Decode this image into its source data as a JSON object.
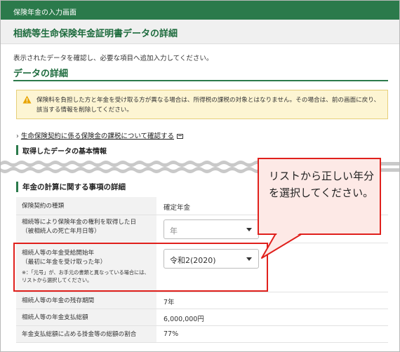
{
  "topbar": {
    "title": "保険年金の入力画面"
  },
  "page": {
    "title": "相続等生命保険年金証明書データの詳細"
  },
  "intro": "表示されたデータを確認し、必要な項目へ追加入力してください。",
  "section": {
    "title": "データの詳細"
  },
  "warning": {
    "icon": "warning-icon",
    "text": "保険料を負担した方と年金を受け取る方が異なる場合は、所得税の課税の対象とはなりません。その場合は、前の画面に戻り、該当する情報を削除してください。"
  },
  "link": {
    "text": "生命保険契約に係る保険金の課税について確認する",
    "icon": "external-link-icon"
  },
  "basic_info": {
    "title": "取得したデータの基本情報"
  },
  "calc": {
    "title": "年金の計算に関する事項の詳細",
    "rows": [
      {
        "label": "保険契約の種類",
        "value": "確定年金"
      },
      {
        "label": "相続等により保険年金の権利を取得した日\n（被相続人の死亡年月日等）",
        "select_placeholder": "年"
      },
      {
        "label": "相続人等の年金受給開始年\n（最初に年金を受け取った年）",
        "note": "※：「元号」が、お手元の書類と異なっている場合には、リストから選択してください。",
        "select_value": "令和2(2020)"
      },
      {
        "label": "相続人等の年金の残存期間",
        "value": "7年"
      },
      {
        "label": "相続人等の年金支払総額",
        "value": "6,000,000円"
      },
      {
        "label": "年金支払総額に占める掛金等の総額の割合",
        "value": "77%"
      }
    ]
  },
  "callout": {
    "text": "リストから正しい年分を選択してください。"
  },
  "colors": {
    "brand_green": "#2b7a4b",
    "highlight_red": "#e0201c",
    "callout_bg": "#fde9e6",
    "warning_bg": "#fdf5d3"
  }
}
